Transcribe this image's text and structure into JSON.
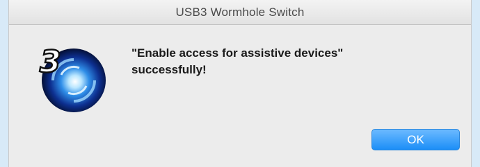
{
  "window": {
    "title": "USB3 Wormhole Switch"
  },
  "icon": {
    "name": "usb3-wormhole-app-icon",
    "numeral": "3"
  },
  "message": {
    "line1": "\"Enable access for assistive devices\"",
    "line2": "successfully!"
  },
  "buttons": {
    "ok_label": "OK"
  },
  "colors": {
    "accent": "#1b8ef7",
    "dialog_bg": "#ececec"
  }
}
